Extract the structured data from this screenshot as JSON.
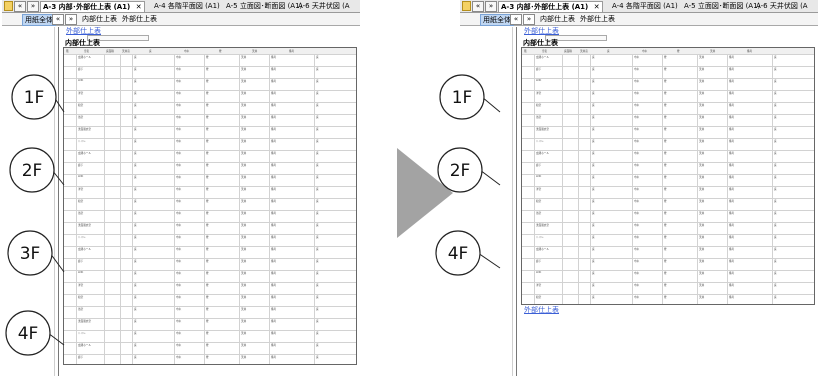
{
  "tabs": {
    "nav_prev": "«",
    "nav_next": "»",
    "active_label": "A-3 内部･外部仕上表 (A1)",
    "close": "✕",
    "items": [
      "A-4 各階平面図 (A1)",
      "A-5 立面図･断面図 (A1)",
      "A-6 天井伏図 (A"
    ]
  },
  "subtabs": {
    "items": [
      "用紙全体",
      "内部仕上表",
      "外部仕上表"
    ]
  },
  "document": {
    "link_top": "外部仕上表",
    "title": "内部仕上表",
    "link_bottom": "外部仕上表"
  },
  "left_callouts": [
    "1F",
    "2F",
    "3F",
    "4F"
  ],
  "right_callouts": [
    "1F",
    "2F",
    "4F"
  ],
  "table_cells": [
    "階",
    "室名",
    "床面積",
    "天井高",
    "床",
    "巾木",
    "壁",
    "天井",
    "備考",
    "玄関ホール",
    "廊下",
    "LDK",
    "洋室",
    "和室",
    "浴室",
    "洗面脱衣室",
    "トイレ"
  ],
  "colors": {
    "arrow": "#a3a3a3",
    "link": "#3b5fd6",
    "active_subtab": "#bfd6f2"
  }
}
